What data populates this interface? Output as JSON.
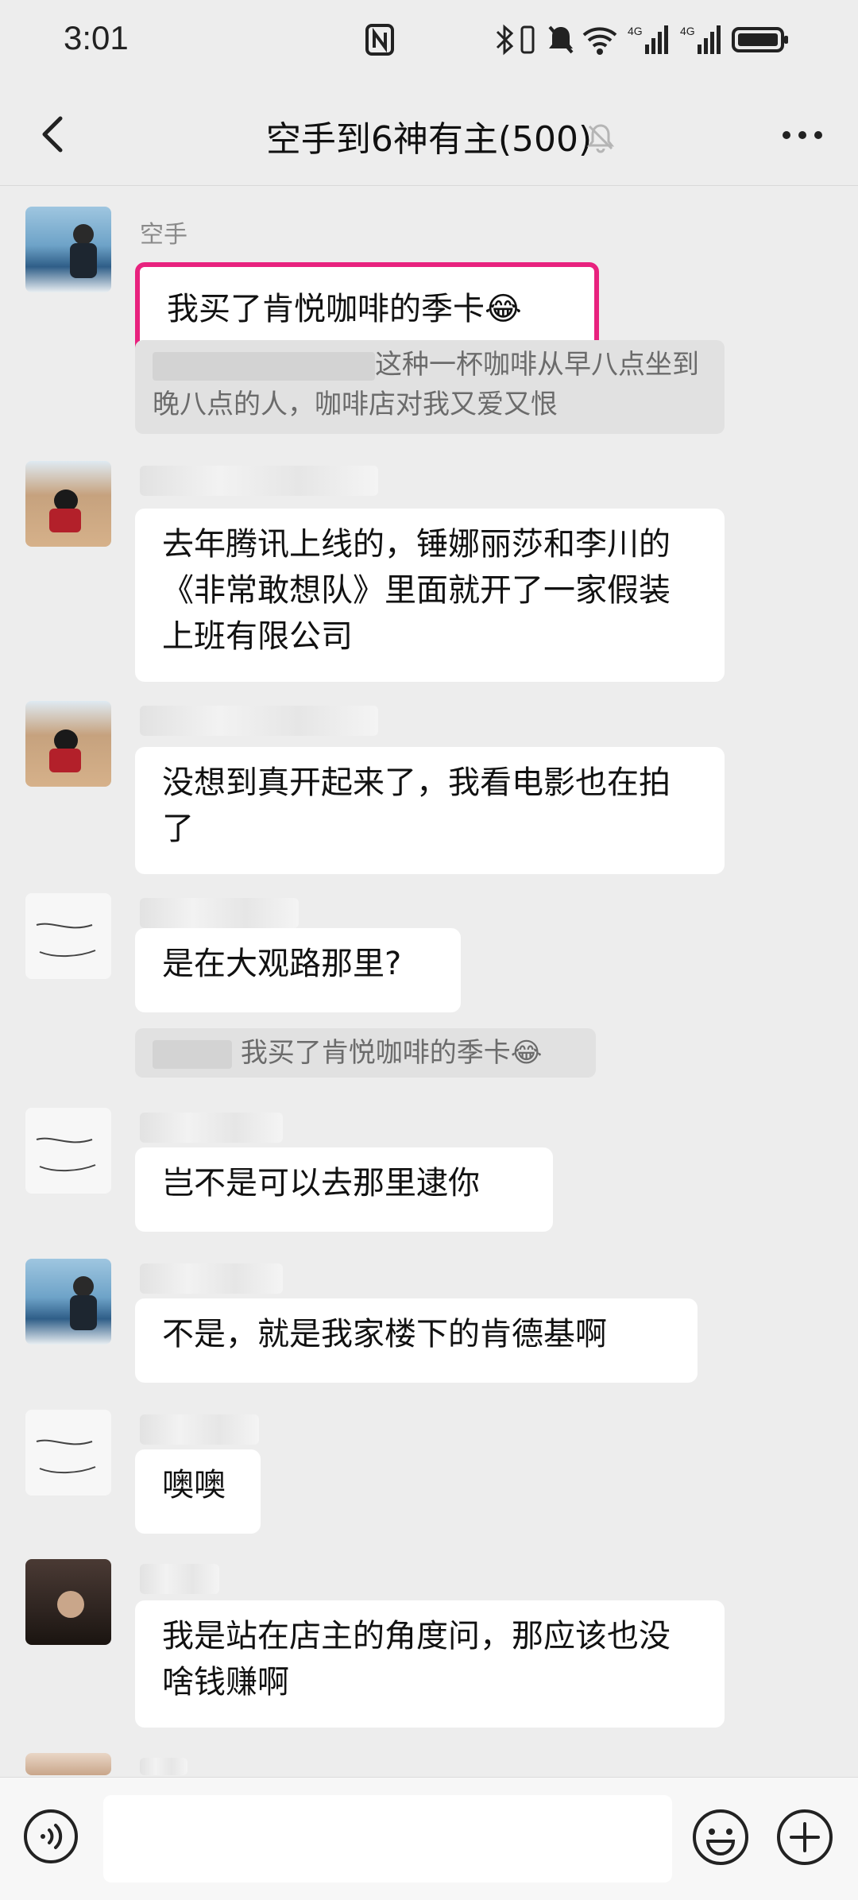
{
  "status": {
    "time": "3:01"
  },
  "nav": {
    "title": "空手到6神有主(500)"
  },
  "messages": [
    {
      "sender": "空手",
      "text": "我买了肯悦咖啡的季卡😂",
      "highlighted": true
    },
    {
      "quote": "这种一杯咖啡从早八点坐到晚八点的人，咖啡店对我又爱又恨"
    },
    {
      "text": "去年腾讯上线的，锤娜丽莎和李川的《非常敢想队》里面就开了一家假装上班有限公司"
    },
    {
      "text": "没想到真开起来了，我看电影也在拍了"
    },
    {
      "text": "是在大观路那里?"
    },
    {
      "quote": "我买了肯悦咖啡的季卡😂"
    },
    {
      "text": "岂不是可以去那里逮你"
    },
    {
      "text": "不是，就是我家楼下的肯德基啊"
    },
    {
      "text": "噢噢"
    },
    {
      "text": "我是站在店主的角度问，那应该也没啥钱赚啊"
    }
  ],
  "input": {
    "placeholder": ""
  },
  "icons": {
    "back": "back-arrow-icon",
    "bell": "muted-bell-icon",
    "more": "more-icon",
    "voice": "voice-icon",
    "emoji": "emoji-icon",
    "plus": "plus-icon"
  },
  "colors": {
    "highlight": "#e8227e",
    "background": "#ededed",
    "bubble": "#ffffff"
  }
}
